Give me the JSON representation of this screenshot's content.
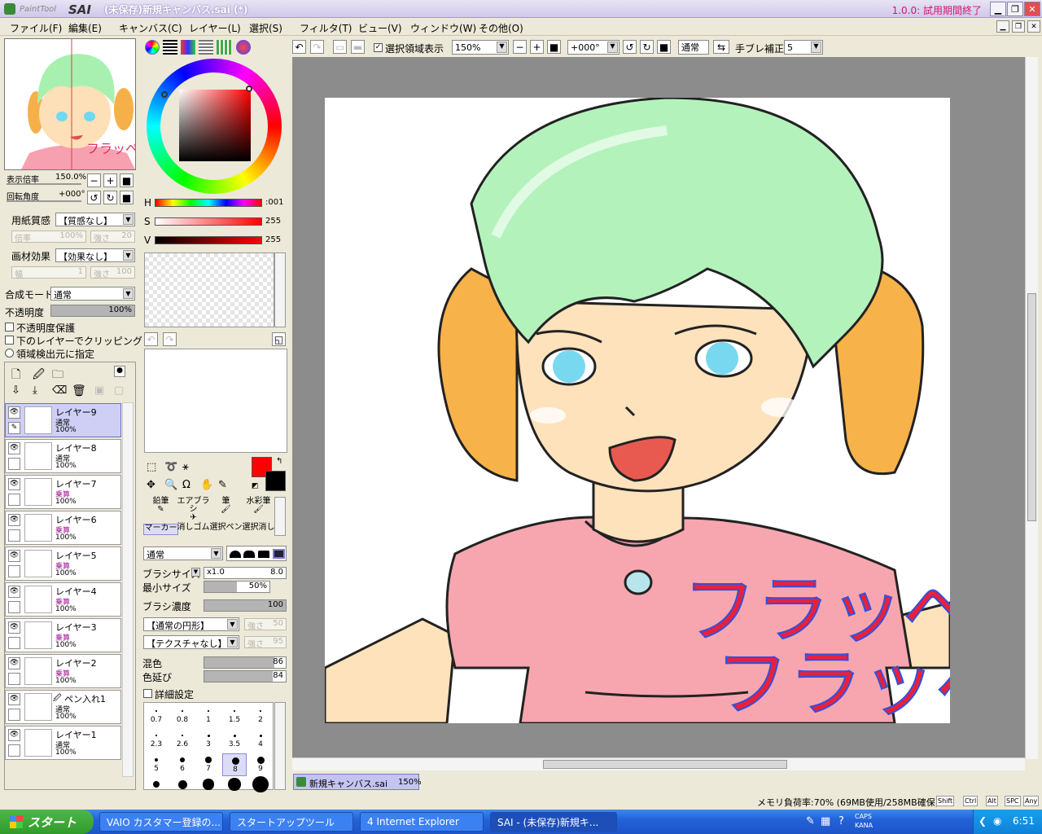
{
  "titlebar": {
    "logo_text": "PaintTool SAI",
    "title": "(未保存)新規キャンバス.sai (*)",
    "trial": "1.0.0: 試用期間終了"
  },
  "menu": [
    "ファイル(F)",
    "編集(E)",
    "キャンバス(C)",
    "レイヤー(L)",
    "選択(S)",
    "フィルタ(T)",
    "ビュー(V)",
    "ウィンドウ(W)",
    "その他(O)"
  ],
  "navigator": {
    "zoom_label": "表示倍率",
    "zoom_value": "150.0%",
    "rotate_label": "回転角度",
    "rotate_value": "+000°"
  },
  "paper": {
    "label": "用紙質感",
    "value": "【質感なし】",
    "scale_label": "倍率",
    "scale_value": "100%",
    "strength_label": "強さ",
    "strength_value": "20"
  },
  "effect": {
    "label": "画材効果",
    "value": "【効果なし】",
    "width_label": "幅",
    "width_value": "1",
    "strength_label": "強さ",
    "strength_value": "100"
  },
  "blend": {
    "label": "合成モード",
    "value": "通常",
    "opacity_label": "不透明度",
    "opacity_value": "100%",
    "opacity_fraction": 1.0
  },
  "checks": [
    "不透明度保護",
    "下のレイヤーでクリッピング",
    "領域検出元に指定"
  ],
  "layers": [
    {
      "name": "レイヤー9",
      "mode": "通常",
      "opacity": "100%",
      "selected": true,
      "pen": true
    },
    {
      "name": "レイヤー8",
      "mode": "通常",
      "opacity": "100%"
    },
    {
      "name": "レイヤー7",
      "mode": "乗算",
      "opacity": "100%"
    },
    {
      "name": "レイヤー6",
      "mode": "乗算",
      "opacity": "100%"
    },
    {
      "name": "レイヤー5",
      "mode": "乗算",
      "opacity": "100%"
    },
    {
      "name": "レイヤー4",
      "mode": "乗算",
      "opacity": "100%"
    },
    {
      "name": "レイヤー3",
      "mode": "乗算",
      "opacity": "100%"
    },
    {
      "name": "レイヤー2",
      "mode": "乗算",
      "opacity": "100%"
    },
    {
      "name": "ペン入れ1",
      "mode": "通常",
      "opacity": "100%",
      "pen_layer": true
    },
    {
      "name": "レイヤー1",
      "mode": "通常",
      "opacity": "100%"
    }
  ],
  "hsv": {
    "h_label": "H",
    "h_value": "001",
    "s_label": "S",
    "s_value": "255",
    "v_label": "V",
    "v_value": "255"
  },
  "colors": {
    "primary": "#ff0000",
    "secondary": "#000000",
    "accent": "#c8c8f4"
  },
  "tools": {
    "row1": [
      "鉛筆",
      "エアブラシ",
      "筆",
      "水彩筆"
    ],
    "row2": [
      "マーカー",
      "消しゴム",
      "選択ペン",
      "選択消し"
    ]
  },
  "brush": {
    "mode_value": "通常",
    "size_label": "ブラシサイズ",
    "size_mult": "x1.0",
    "size_value": "8.0",
    "min_label": "最小サイズ",
    "min_value": "50%",
    "min_fraction": 0.5,
    "density_label": "ブラシ濃度",
    "density_value": "100",
    "density_fraction": 1.0,
    "shape_value": "【通常の円形】",
    "shape_strength_label": "強さ",
    "shape_strength_value": "50",
    "texture_value": "【テクスチャなし】",
    "texture_strength_label": "強さ",
    "texture_strength_value": "95",
    "mix_label": "混色",
    "mix_value": "86",
    "mix_fraction": 0.86,
    "stretch_label": "色延び",
    "stretch_value": "84",
    "stretch_fraction": 0.84,
    "detail_label": "詳細設定"
  },
  "size_presets": [
    "0.7",
    "0.8",
    "1",
    "1.5",
    "2",
    "2.3",
    "2.6",
    "3",
    "3.5",
    "4",
    "5",
    "6",
    "7",
    "8",
    "9"
  ],
  "toolbar": {
    "selection_label": "選択領域表示",
    "zoom_value": "150%",
    "rotate_value": "+000°",
    "mode_value": "通常",
    "stabilizer_label": "手ブレ補正",
    "stabilizer_value": "5"
  },
  "canvas_text": [
    "フラッペ",
    "フラッペ"
  ],
  "doc_tab": {
    "name": "新規キャンバス.sai",
    "zoom": "150%"
  },
  "status": {
    "memory": "メモリ負荷率:70% (69MB使用/258MB確保)",
    "keys": [
      "Shift",
      "Ctrl",
      "Alt",
      "SPC",
      "Any"
    ]
  },
  "taskbar": {
    "start_label": "スタート",
    "tasks": [
      "VAIO カスタマー登録の...",
      "スタートアップツール",
      "4 Internet Explorer",
      "SAI - (未保存)新規キ..."
    ],
    "tray_time": "6:51",
    "caps": "CAPS",
    "kana": "KANA"
  }
}
